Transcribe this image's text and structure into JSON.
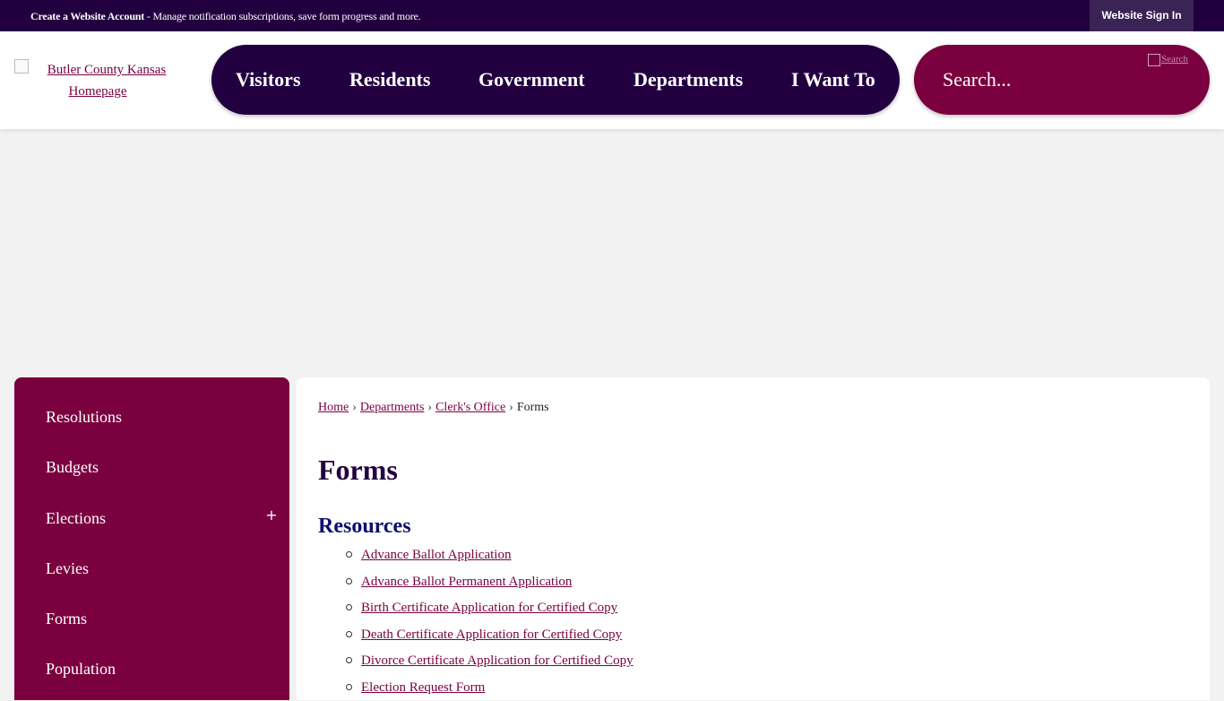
{
  "topbar": {
    "notice_bold": "Create a Website Account",
    "notice_text": " - Manage notification subscriptions, save form progress and more.",
    "signin_label": "Website Sign In"
  },
  "header": {
    "logo_alt": "Butler County Kansas Homepage",
    "nav": [
      "Visitors",
      "Residents",
      "Government",
      "Departments",
      "I Want To"
    ],
    "search_placeholder": "Search...",
    "search_button_alt": "Search"
  },
  "sidebar": {
    "items": [
      "Resolutions",
      "Budgets",
      "Elections",
      "Levies",
      "Forms",
      "Population"
    ],
    "expand_symbol": "+"
  },
  "breadcrumb": {
    "items": [
      "Home",
      "Departments",
      "Clerk's Office"
    ],
    "current": "Forms",
    "separator": "›"
  },
  "main": {
    "title": "Forms",
    "section_title": "Resources",
    "links": [
      "Advance Ballot Application",
      "Advance Ballot Permanent Application",
      "Birth Certificate Application for Certified Copy",
      "Death Certificate Application for Certified Copy",
      "Divorce Certificate Application for Certified Copy",
      "Election Request Form"
    ]
  },
  "colors": {
    "nav_dark": "#220040",
    "accent_maroon": "#7a0040",
    "page_bg": "#f2f2f2",
    "section_title": "#0e0f6e"
  }
}
